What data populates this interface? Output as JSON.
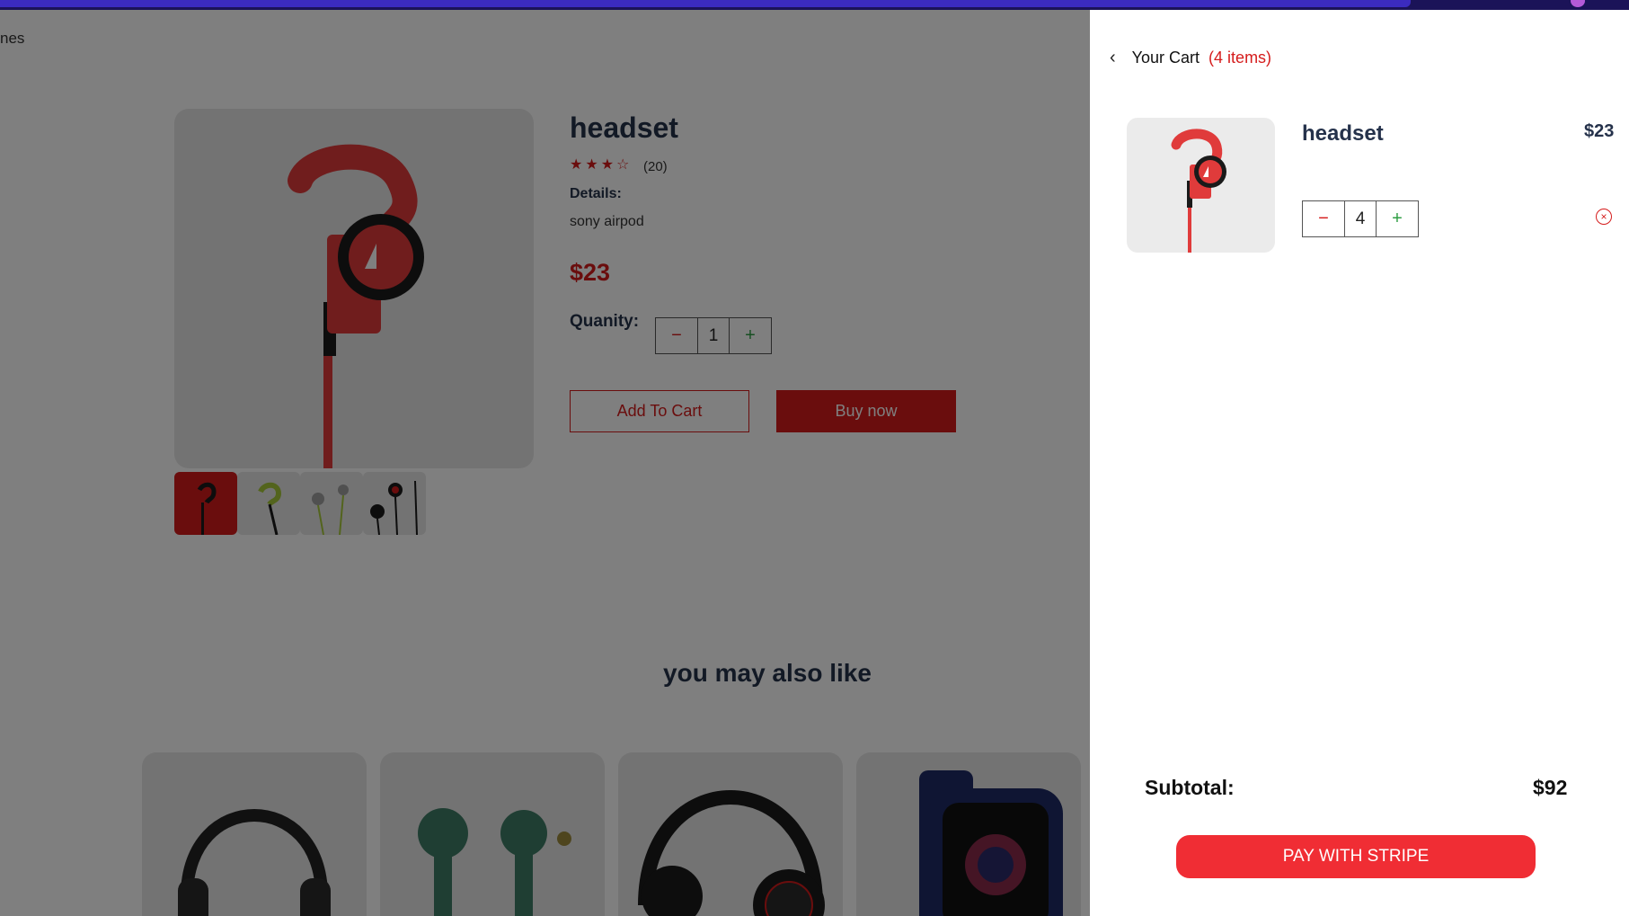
{
  "breadcrumb": {
    "text": "nes"
  },
  "product": {
    "title": "headset",
    "stars": "★★★☆",
    "review_count": "(20)",
    "details_label": "Details:",
    "details_text": "sony airpod",
    "price": "$23",
    "quantity_label": "Quanity:",
    "quantity": "1",
    "add_to_cart": "Add To Cart",
    "buy_now": "Buy now"
  },
  "recommendations": {
    "title": "you may also like"
  },
  "cart": {
    "back_icon": "‹",
    "title": "Your Cart",
    "count_text": "(4 items)",
    "item": {
      "name": "headset",
      "price": "$23",
      "quantity": "4",
      "remove_icon": "×"
    },
    "subtotal_label": "Subtotal:",
    "subtotal_value": "$92",
    "pay_button": "PAY WITH STRIPE"
  },
  "qty_controls": {
    "minus": "−",
    "plus": "+"
  },
  "colors": {
    "accent_red": "#d51b1b",
    "pay_red": "#f02d34",
    "heading_navy": "#25324b",
    "plus_green": "#2f9e44"
  },
  "icons": {
    "back": "chevron-left-icon",
    "remove": "close-circle-icon",
    "minus": "minus-icon",
    "plus": "plus-icon"
  }
}
